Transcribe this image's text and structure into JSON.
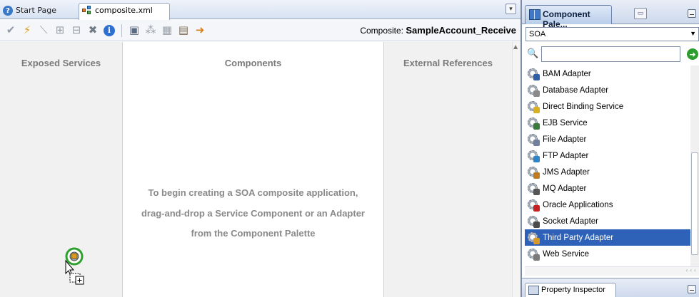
{
  "tabs": {
    "start_page": "Start Page",
    "composite_file": "composite.xml"
  },
  "toolbar": {
    "icons": [
      "validate-icon",
      "lightning-icon",
      "line-icon",
      "insert-icon",
      "remove-icon",
      "delete-icon",
      "info-icon",
      "db-icon",
      "graph-icon",
      "table-icon",
      "export-icon",
      "arrow-icon"
    ],
    "composite_label": "Composite:",
    "composite_name": "SampleAccount_Receive"
  },
  "swimlanes": {
    "exposed_services": "Exposed Services",
    "components": "Components",
    "external_references": "External References"
  },
  "hint": {
    "line1": "To begin creating a SOA composite application,",
    "line2": "drag-and-drop a Service Component or an Adapter",
    "line3": "from the Component Palette"
  },
  "palette": {
    "title": "Component Pale...",
    "category": "SOA",
    "search_value": "",
    "items": [
      {
        "label": "BAM Adapter",
        "badge": "#2e5fa8"
      },
      {
        "label": "Database Adapter",
        "badge": "#8a8a8a"
      },
      {
        "label": "Direct Binding Service",
        "badge": "#d8b020"
      },
      {
        "label": "EJB Service",
        "badge": "#3a7a3a"
      },
      {
        "label": "File Adapter",
        "badge": "#6f7f9c"
      },
      {
        "label": "FTP Adapter",
        "badge": "#2e84c8"
      },
      {
        "label": "JMS Adapter",
        "badge": "#c07a20"
      },
      {
        "label": "MQ Adapter",
        "badge": "#555555"
      },
      {
        "label": "Oracle Applications",
        "badge": "#c82020"
      },
      {
        "label": "Socket Adapter",
        "badge": "#4a4a4a"
      },
      {
        "label": "Third Party Adapter",
        "badge": "#d89a20",
        "selected": true
      },
      {
        "label": "Web Service",
        "badge": "#7a7a7a"
      }
    ]
  },
  "property_inspector": {
    "title": "Property Inspector"
  }
}
